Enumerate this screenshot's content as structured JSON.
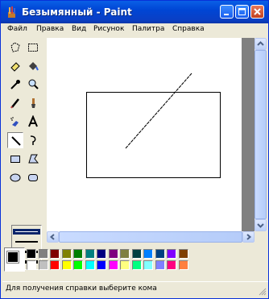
{
  "window": {
    "title": "Безымянный - Paint",
    "controls": [
      "minimize",
      "maximize",
      "close"
    ]
  },
  "menu": [
    "Файл",
    "Правка",
    "Вид",
    "Рисунок",
    "Палитра",
    "Справка"
  ],
  "tools": [
    "free-select",
    "rect-select",
    "eraser",
    "fill",
    "color-picker",
    "magnifier",
    "pencil",
    "brush",
    "airbrush",
    "text",
    "line",
    "curve",
    "rectangle",
    "polygon",
    "ellipse",
    "rounded-rectangle"
  ],
  "selected_tool": "line",
  "line_widths": [
    1,
    2,
    3,
    4
  ],
  "selected_line_width": 1,
  "colors": {
    "foreground": "#000000",
    "background": "#ffffff",
    "palette": [
      "#000000",
      "#808080",
      "#800000",
      "#808000",
      "#008000",
      "#008080",
      "#000080",
      "#800080",
      "#808040",
      "#004040",
      "#0080ff",
      "#004080",
      "#8000ff",
      "#804000",
      "#ffffff",
      "#c0c0c0",
      "#ff0000",
      "#ffff00",
      "#00ff00",
      "#00ffff",
      "#0000ff",
      "#ff00ff",
      "#ffff80",
      "#00ff80",
      "#80ffff",
      "#8080ff",
      "#ff0080",
      "#ff8040"
    ]
  },
  "status": {
    "text": "Для получения справки выберите кома"
  }
}
